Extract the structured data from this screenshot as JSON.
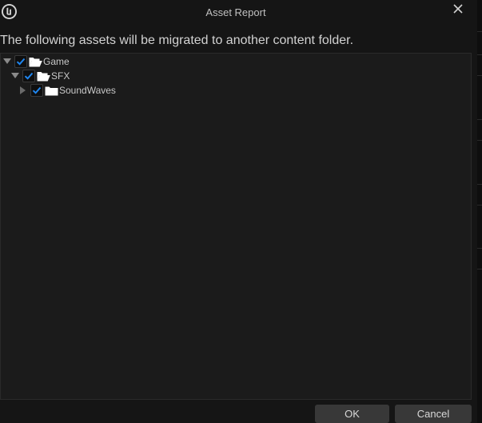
{
  "window": {
    "title": "Asset Report",
    "message": "The following assets will be migrated to another content folder."
  },
  "tree": {
    "items": [
      {
        "label": "Game",
        "expanded": true,
        "checked": true,
        "depth": 0
      },
      {
        "label": "SFX",
        "expanded": true,
        "checked": true,
        "depth": 1
      },
      {
        "label": "SoundWaves",
        "expanded": false,
        "checked": true,
        "depth": 2
      }
    ]
  },
  "footer": {
    "ok_label": "OK",
    "cancel_label": "Cancel"
  },
  "icons": {
    "logo": "unreal-logo-icon",
    "close": "close-icon",
    "expander_open": "triangle-down-icon",
    "expander_closed": "triangle-right-icon",
    "checkbox": "check-icon",
    "folder_open": "folder-open-icon",
    "folder_closed": "folder-icon"
  },
  "colors": {
    "background": "#151515",
    "panel": "#1b1b1b",
    "button": "#383838",
    "check": "#1f86f0"
  }
}
